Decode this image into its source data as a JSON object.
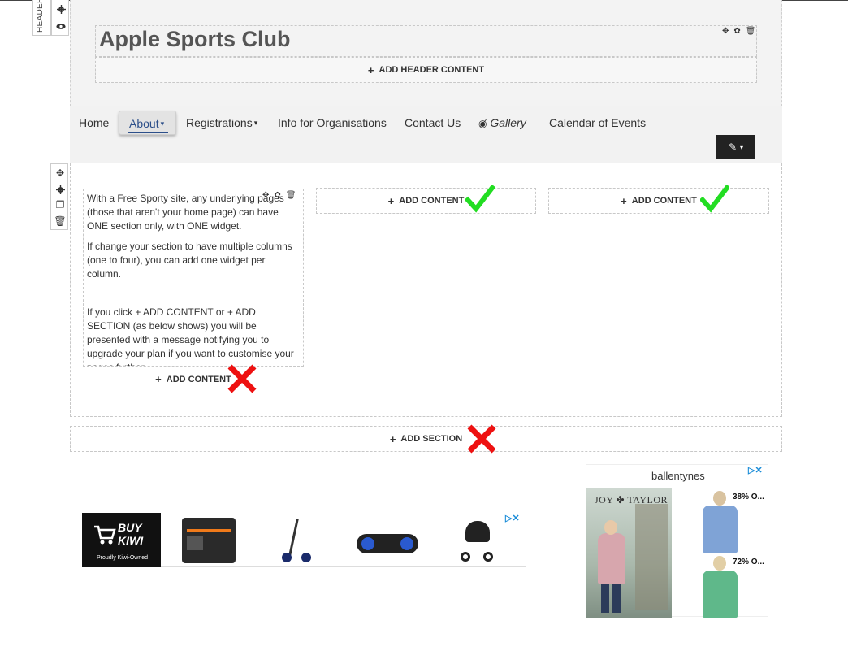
{
  "header_toolbar": {
    "label": "HEADER"
  },
  "header": {
    "site_title": "Apple Sports Club",
    "add_header_label": "ADD HEADER CONTENT"
  },
  "nav": {
    "items": [
      "Home",
      "About",
      "Registrations",
      "Info for Organisations",
      "Contact Us",
      "Gallery",
      "Calendar of Events"
    ],
    "active": "About"
  },
  "section": {
    "column1_paragraphs": [
      "With a Free Sporty site, any underlying pages (those that aren't your home page) can have ONE section only, with ONE widget.",
      "If change your section to have multiple columns (one to four), you can add one widget per column.",
      "If you click + ADD CONTENT or + ADD SECTION (as below shows) you will be presented with a message notifying you to upgrade your plan if you want to customise your pages further."
    ],
    "add_content_label": "ADD CONTENT",
    "add_section_label": "ADD SECTION"
  },
  "ads": {
    "kiwi_line1": "BUY",
    "kiwi_line2": "KIWI",
    "kiwi_tagline": "Proudly Kiwi-Owned",
    "brand": "ballentynes",
    "photo_brand": "JOY ✤ TAYLOR",
    "discount1": "38% O...",
    "discount2": "72% O..."
  },
  "colors": {
    "check": "#22dd22",
    "cross": "#ee1111",
    "accent": "#2c4f8a",
    "edit_button": "#222222"
  }
}
